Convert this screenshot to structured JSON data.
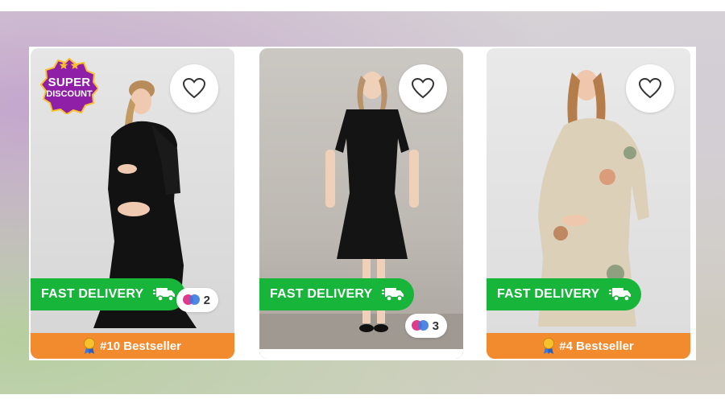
{
  "products": [
    {
      "promo_badge": {
        "line1": "SUPER",
        "line2": "DISCOUNT",
        "icon": "star-icon"
      },
      "favorite_icon": "heart-icon",
      "fast_delivery_label": "FAST DELIVERY",
      "color_count": "2",
      "bestseller_label": "#10 Bestseller",
      "dress_color": "#111111"
    },
    {
      "favorite_icon": "heart-icon",
      "fast_delivery_label": "FAST DELIVERY",
      "color_count": "3",
      "dress_color": "#141414"
    },
    {
      "favorite_icon": "heart-icon",
      "fast_delivery_label": "FAST DELIVERY",
      "bestseller_label": "#4 Bestseller",
      "dress_color": "#d9cdb6"
    }
  ],
  "colors": {
    "fast_delivery_green": "#17b53a",
    "bestseller_orange": "#f28a2e",
    "promo_purple": "#8e1fa6",
    "promo_yellow": "#f7c12d"
  }
}
